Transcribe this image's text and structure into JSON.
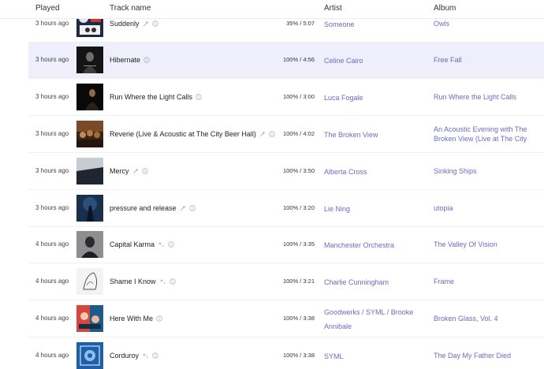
{
  "header": {
    "played": "Played",
    "track_name": "Track name",
    "artist": "Artist",
    "album": "Album"
  },
  "colors": {
    "link": "#6b6bc4",
    "selected_row": "#efeffb",
    "text": "#1e1e1e"
  },
  "rows": [
    {
      "played": "3 hours ago",
      "title": "Suddenly",
      "icons": [
        "pin-icon",
        "info-icon"
      ],
      "progress": "35% / 5:07",
      "artists": [
        "Someone"
      ],
      "album": "Owls",
      "art": "art-suddenly",
      "selected": false
    },
    {
      "played": "3 hours ago",
      "title": "Hibernate",
      "icons": [
        "info-icon"
      ],
      "progress": "100% / 4:56",
      "artists": [
        "Celine Cairo"
      ],
      "album": "Free Fall",
      "art": "art-hibernate",
      "selected": true
    },
    {
      "played": "3 hours ago",
      "title": "Run Where the Light Calls",
      "icons": [
        "info-icon"
      ],
      "progress": "100% / 3:00",
      "artists": [
        "Luca Fogale"
      ],
      "album": "Run Where the Light Calls",
      "art": "art-run",
      "selected": false
    },
    {
      "played": "3 hours ago",
      "title": "Reverie (Live & Acoustic at The City Beer Hall)",
      "icons": [
        "pin-icon",
        "info-icon"
      ],
      "progress": "100% / 4:02",
      "artists": [
        "The Broken View"
      ],
      "album": "An Acoustic Evening with The Broken View (Live at The City",
      "art": "art-reverie",
      "selected": false
    },
    {
      "played": "3 hours ago",
      "title": "Mercy",
      "icons": [
        "pin-icon",
        "info-icon"
      ],
      "progress": "100% / 3:50",
      "artists": [
        "Alberta Cross"
      ],
      "album": "Sinking Ships",
      "art": "art-mercy",
      "selected": false
    },
    {
      "played": "3 hours ago",
      "title": "pressure and release",
      "icons": [
        "pin-icon",
        "info-icon"
      ],
      "progress": "100% / 3:20",
      "artists": [
        "Lie Ning"
      ],
      "album": "utopia",
      "art": "art-pressure",
      "selected": false
    },
    {
      "played": "4 hours ago",
      "title": "Capital Karma",
      "icons": [
        "sparkle-icon",
        "info-icon"
      ],
      "progress": "100% / 3:35",
      "artists": [
        "Manchester Orchestra"
      ],
      "album": "The Valley Of Vision",
      "art": "art-capital",
      "selected": false
    },
    {
      "played": "4 hours ago",
      "title": "Shame I Know",
      "icons": [
        "sparkle-icon",
        "info-icon"
      ],
      "progress": "100% / 3:21",
      "artists": [
        "Charlie Cunningham"
      ],
      "album": "Frame",
      "art": "art-shame",
      "selected": false
    },
    {
      "played": "4 hours ago",
      "title": "Here With Me",
      "icons": [
        "info-icon"
      ],
      "progress": "100% / 3:38",
      "artists": [
        "Goodwerks",
        "SYML",
        "Brooke Annibale"
      ],
      "album": "Broken Glass, Vol. 4",
      "art": "art-herewithme",
      "selected": false
    },
    {
      "played": "4 hours ago",
      "title": "Corduroy",
      "icons": [
        "sparkle-icon",
        "info-icon"
      ],
      "progress": "100% / 3:38",
      "artists": [
        "SYML"
      ],
      "album": "The Day My Father Died",
      "art": "art-corduroy",
      "selected": false
    }
  ]
}
